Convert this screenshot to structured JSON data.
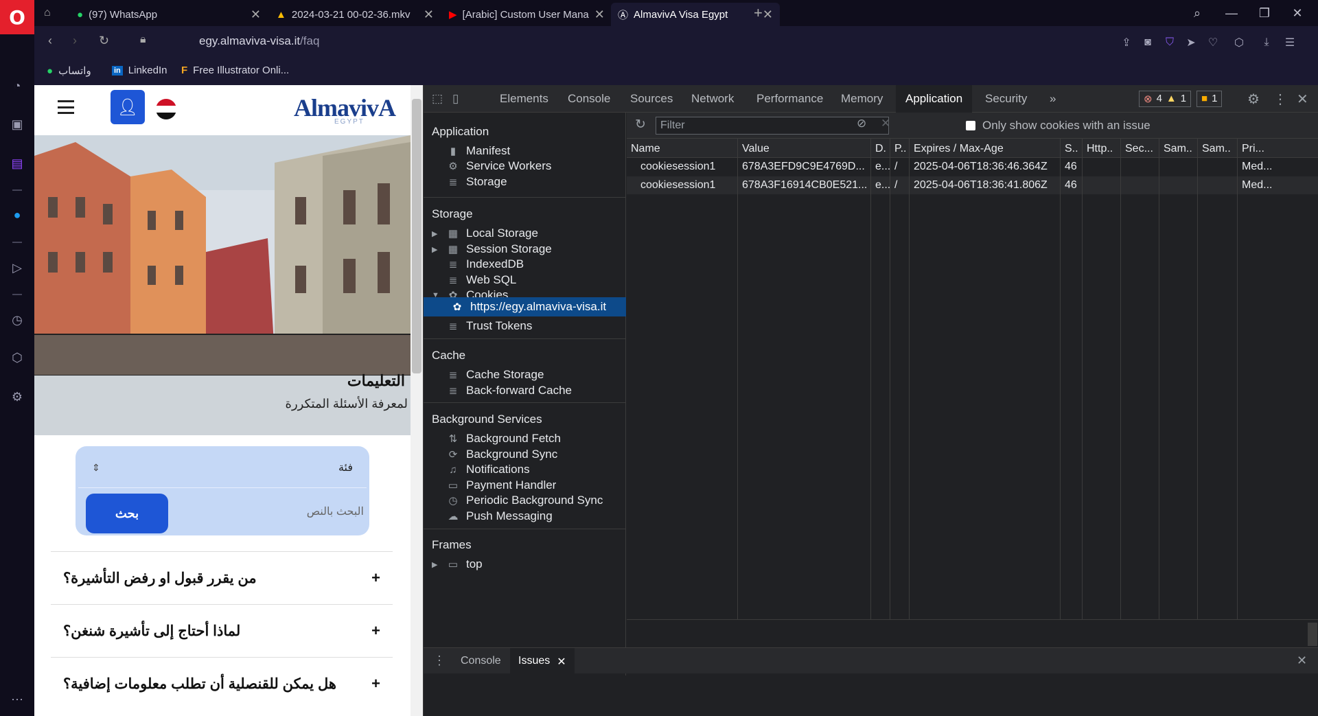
{
  "browser": {
    "tabs": [
      {
        "label": "(97) WhatsApp",
        "icon": "whatsapp-icon"
      },
      {
        "label": "2024-03-21 00-02-36.mkv",
        "icon": "google-drive-icon"
      },
      {
        "label": "[Arabic] Custom User Mana",
        "icon": "youtube-icon"
      },
      {
        "label": "AlmavivA Visa Egypt",
        "icon": "almaviva-icon"
      }
    ],
    "url_host": "egy.almaviva-visa.it",
    "url_path": "/faq",
    "bookmarks": [
      {
        "label": "واتساب",
        "icon": "whatsapp-icon"
      },
      {
        "label": "LinkedIn",
        "icon": "linkedin-icon"
      },
      {
        "label": "Free Illustrator Onli...",
        "icon": "f-icon"
      }
    ]
  },
  "page": {
    "logo": "AlmavivA",
    "logo_sub": "EGYPT",
    "hero_title": "التعليمات",
    "hero_sub": "لمعرفة الأسئلة المتكررة",
    "category": "فئة",
    "search_placeholder": "البحث بالنص",
    "search_button": "بحث",
    "faqs": [
      "من يقرر قبول او رفض التأشيرة؟",
      "لماذا أحتاج إلى تأشيرة شنغن؟",
      "هل يمكن للقنصلية أن تطلب معلومات إضافية؟"
    ]
  },
  "devtools": {
    "tabs": [
      "Elements",
      "Console",
      "Sources",
      "Network",
      "Performance",
      "Memory",
      "Application",
      "Security"
    ],
    "active_tab": "Application",
    "errors": "4",
    "warnings": "1",
    "issues": "1",
    "filter_placeholder": "Filter",
    "only_issue_label": "Only show cookies with an issue",
    "sidebar": {
      "application_head": "Application",
      "application_items": [
        "Manifest",
        "Service Workers",
        "Storage"
      ],
      "storage_head": "Storage",
      "storage_items": [
        "Local Storage",
        "Session Storage",
        "IndexedDB",
        "Web SQL",
        "Cookies"
      ],
      "cookie_origin": "https://egy.almaviva-visa.it",
      "trust_tokens": "Trust Tokens",
      "cache_head": "Cache",
      "cache_items": [
        "Cache Storage",
        "Back-forward Cache"
      ],
      "bg_head": "Background Services",
      "bg_items": [
        "Background Fetch",
        "Background Sync",
        "Notifications",
        "Payment Handler",
        "Periodic Background Sync",
        "Push Messaging"
      ],
      "frames_head": "Frames",
      "frames_item": "top"
    },
    "columns": [
      "Name",
      "Value",
      "D.",
      "P..",
      "Expires / Max-Age",
      "S..",
      "Http..",
      "Sec...",
      "Sam..",
      "Sam..",
      "Pri..."
    ],
    "rows": [
      [
        "cookiesession1",
        "678A3EFD9C9E4769D...",
        "e...",
        "/",
        "2025-04-06T18:36:46.364Z",
        "46",
        "",
        "",
        "",
        "",
        "Med..."
      ],
      [
        "cookiesession1",
        "678A3F16914CB0E521...",
        "e...",
        "/",
        "2025-04-06T18:36:41.806Z",
        "46",
        "",
        "",
        "",
        "",
        "Med..."
      ]
    ],
    "drawer_tabs": [
      "Console",
      "Issues"
    ]
  }
}
